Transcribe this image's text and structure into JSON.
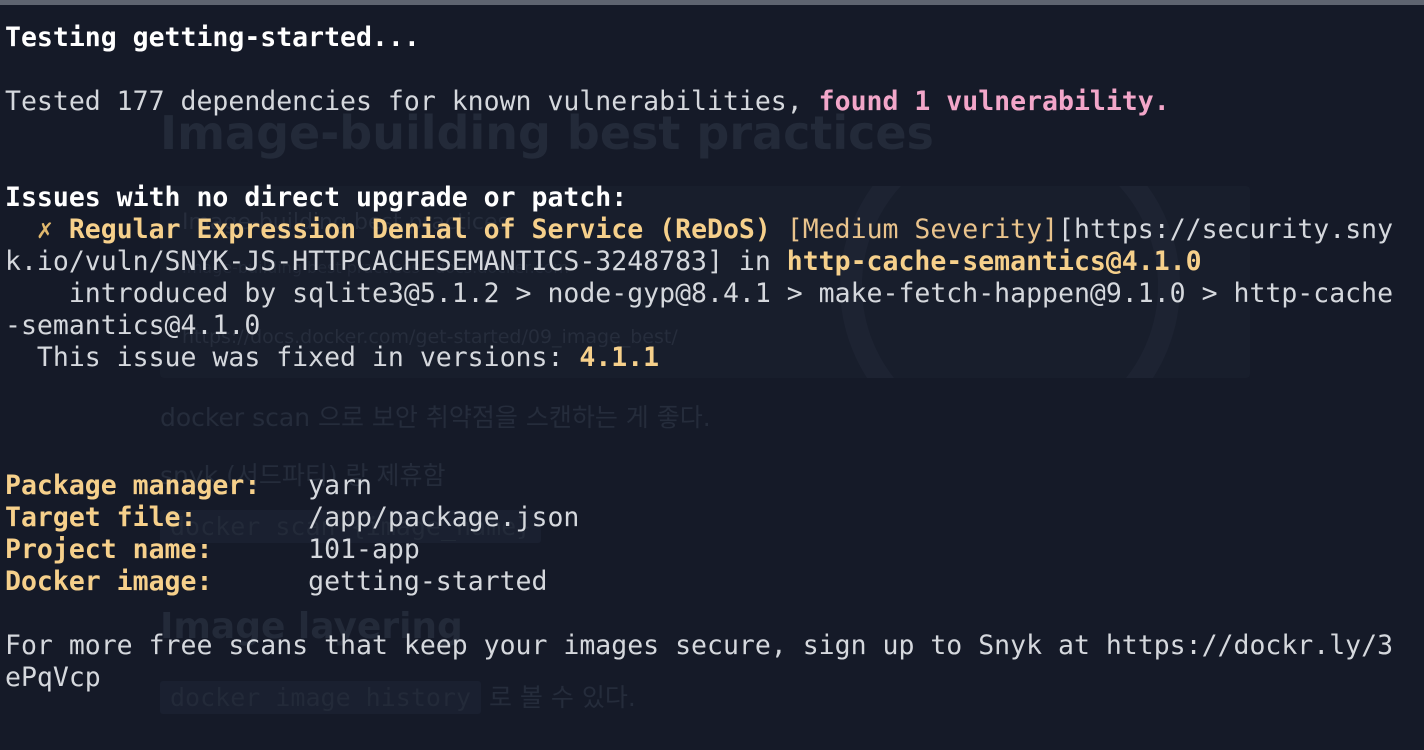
{
  "background": {
    "title": "Image-building best practices",
    "card_title": "Image-building best practices",
    "card_subtitle": "Image-building best practices · docs.docker.com",
    "card_link": "https://docs.docker.com/get-started/09_image_best/",
    "note1": "docker scan 으로 보안 취약점을 스캔하는 게 좋다.",
    "note2": "snyk (서드파티) 랑 제휴함",
    "code1": "docker scan {image_name}",
    "heading": "Image layering",
    "code2": "docker image history",
    "note3": " 로 볼 수 있다."
  },
  "terminal": {
    "testing": "Testing getting-started...",
    "tested_prefix": "Tested 177 dependencies for known vulnerabilities, ",
    "tested_found": "found 1 vulnerability.",
    "issues_header": "Issues with no direct upgrade or patch:",
    "issue": {
      "indent": "  ",
      "cross": "✗",
      "title": " Regular Expression Denial of Service (ReDoS) ",
      "severity": "[Medium Severity]",
      "url_part1": "[https://security.sny",
      "url_part2": "k.io/vuln/SNYK-JS-HTTPCACHESEMANTICS-3248783] in ",
      "package": "http-cache-semantics@4.1.0",
      "introduced_1": "    introduced by sqlite3@5.1.2 > node-gyp@8.4.1 > make-fetch-happen@9.1.0 > http-cache",
      "introduced_2": "-semantics@4.1.0",
      "fixed_prefix": "  This issue was fixed in versions: ",
      "fixed_version": "4.1.1"
    },
    "info": [
      {
        "label": "Package manager:",
        "value": "   yarn"
      },
      {
        "label": "Target file:",
        "value": "       /app/package.json"
      },
      {
        "label": "Project name:",
        "value": "      101-app"
      },
      {
        "label": "Docker image:",
        "value": "      getting-started"
      }
    ],
    "footer_1": "For more free scans that keep your images secure, sign up to Snyk at https://dockr.ly/3",
    "footer_2": "ePqVcp"
  },
  "colors": {
    "background": "#151a28",
    "text": "#d5d8dd",
    "found_highlight": "#f2a6c9",
    "label_yellow": "#f6d08b",
    "severity": "#e9c38c"
  }
}
